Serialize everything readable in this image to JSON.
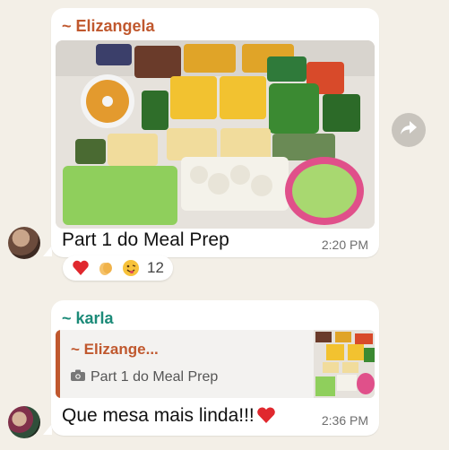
{
  "message1": {
    "sender": "~ Elizangela",
    "caption": "Part 1 do Meal Prep",
    "time": "2:20 PM",
    "photo_icon": "meal-prep-photo",
    "reactions": {
      "emojis": [
        "red-heart",
        "clapping-hands",
        "smiling-face-tongue"
      ],
      "count": "12"
    }
  },
  "message2": {
    "sender": "~ karla",
    "quote": {
      "name": "~ Elizange...",
      "text": "Part 1 do Meal Prep",
      "icon": "camera-icon"
    },
    "caption": "Que mesa mais linda!!!",
    "emoji": "red-heart",
    "time": "2:36 PM"
  },
  "forward_icon": "forward-arrow-icon",
  "colors": {
    "background": "#f3efe7",
    "sender1": "#c0582e",
    "sender2": "#1b8a78",
    "bubble": "#ffffff"
  }
}
